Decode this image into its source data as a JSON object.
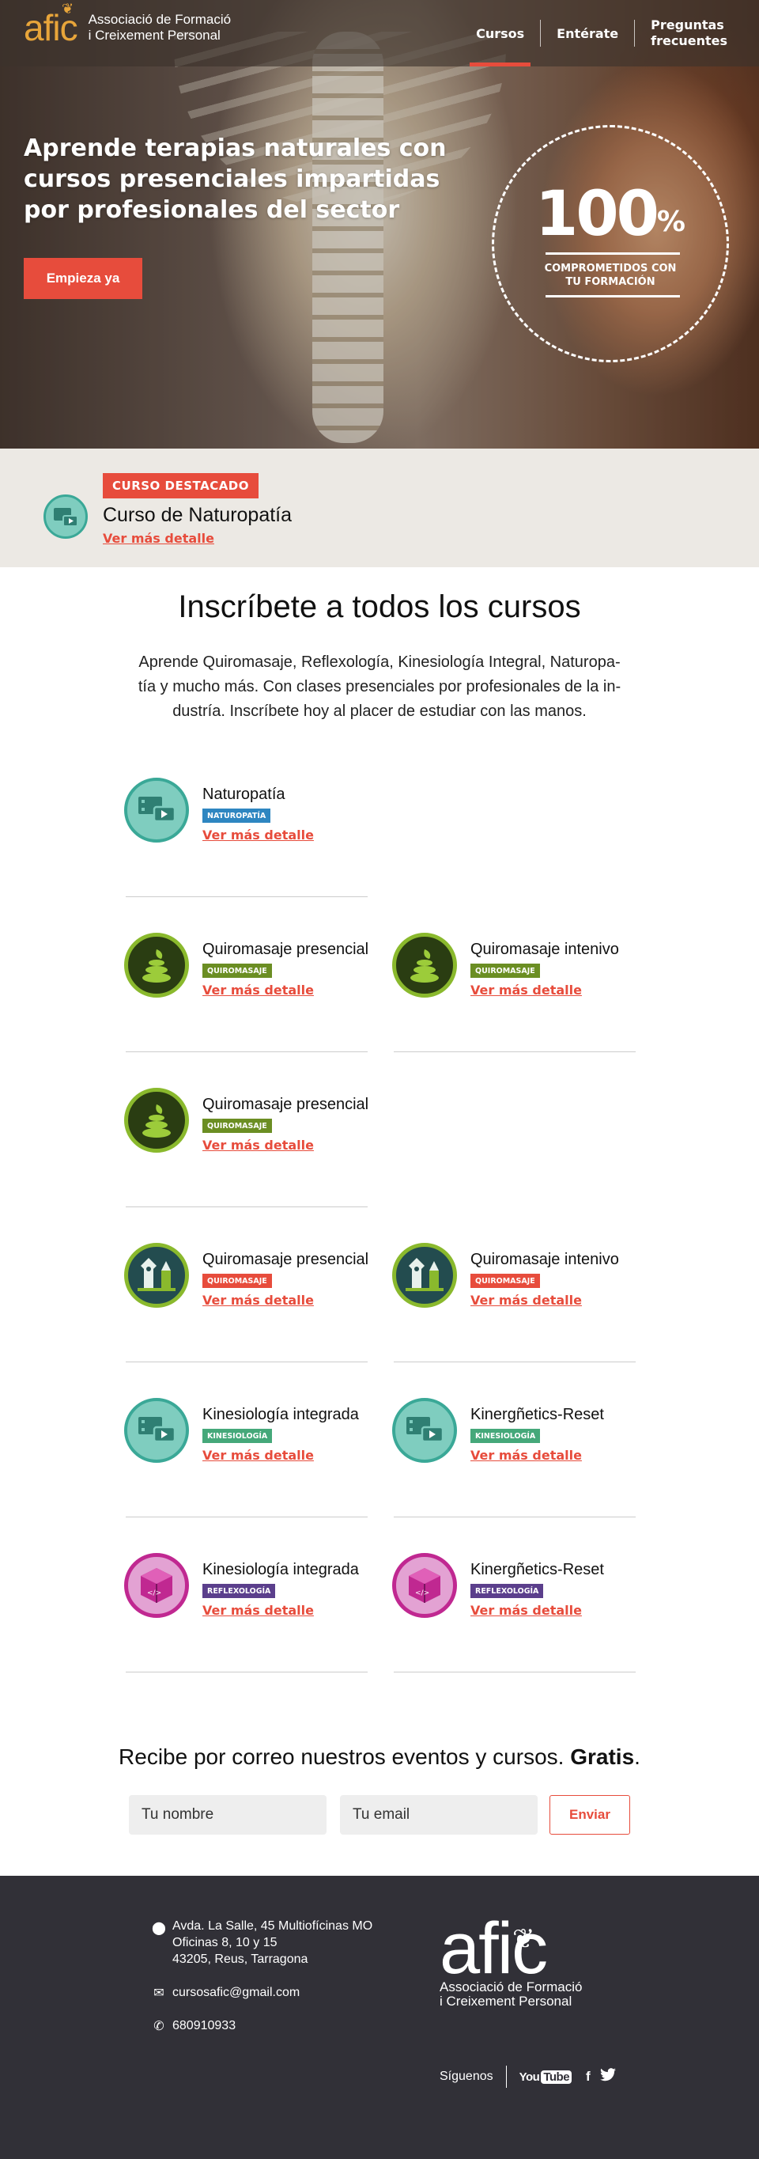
{
  "header": {
    "logo_mark": "afic",
    "logo_line1": "Associació de Formació",
    "logo_line2": "i Creixement Personal",
    "nav": [
      {
        "label": "Cursos"
      },
      {
        "label": "Entérate"
      },
      {
        "label_line1": "Preguntas",
        "label_line2": "frecuentes"
      }
    ]
  },
  "hero": {
    "title_line1": "Aprende terapias naturales con",
    "title_line2": "cursos presenciales impartidas",
    "title_line3": "por profesionales del sector",
    "cta": "Empieza ya",
    "badge_value": "100",
    "badge_unit": "%",
    "badge_text_line1": "COMPROMETIDOS CON",
    "badge_text_line2": "TU FORMACIÓN"
  },
  "featured": {
    "tag": "CURSO DESTACADO",
    "title": "Curso de Naturopatía",
    "link": "Ver más detalle",
    "icon": "video-icon"
  },
  "intro": {
    "title": "Inscríbete a todos los cursos",
    "desc_line1": "Aprende Quiromasaje, Reflexología, Kinesiología Integral, Naturopa-",
    "desc_line2": "tía y mucho más. Con clases presenciales por profesionales de la in-",
    "desc_line3": "dustría. Inscríbete hoy al placer de estudiar con las manos."
  },
  "courses": [
    {
      "name": "Naturopatía",
      "tag": "NATUROPATÍA",
      "tag_color": "#2e86c1",
      "link": "Ver más detalle",
      "icon": "video-icon"
    },
    {
      "name": "Quiromasaje presencial",
      "tag": "QUIROMASAJE",
      "tag_color": "#6b8e23",
      "link": "Ver más detalle",
      "icon": "stones-icon"
    },
    {
      "name": "Quiromasaje intenivo",
      "tag": "QUIROMASAJE",
      "tag_color": "#6b8e23",
      "link": "Ver más detalle",
      "icon": "stones-icon"
    },
    {
      "name": "Quiromasaje presencial",
      "tag": "QUIROMASAJE",
      "tag_color": "#6b8e23",
      "link": "Ver más detalle",
      "icon": "stones-icon"
    },
    {
      "name": "Quiromasaje presencial",
      "tag": "QUIROMASAJE",
      "tag_color": "#e74c3c",
      "link": "Ver más detalle",
      "icon": "pen-icon"
    },
    {
      "name": "Quiromasaje intenivo",
      "tag": "QUIROMASAJE",
      "tag_color": "#e74c3c",
      "link": "Ver más detalle",
      "icon": "pen-icon"
    },
    {
      "name": "Kinesiología integrada",
      "tag": "KINESIOLOGÍA",
      "tag_color": "#45a87a",
      "link": "Ver más detalle",
      "icon": "video-icon"
    },
    {
      "name": "Kinergñetics-Reset",
      "tag": "KINESIOLOGÍA",
      "tag_color": "#45a87a",
      "link": "Ver más detalle",
      "icon": "video-icon"
    },
    {
      "name": "Kinesiología integrada",
      "tag": "REFLEXOLOGÍA",
      "tag_color": "#5b3f8c",
      "link": "Ver más detalle",
      "icon": "box-icon"
    },
    {
      "name": "Kinergñetics-Reset",
      "tag": "REFLEXOLOGÍA",
      "tag_color": "#5b3f8c",
      "link": "Ver más detalle",
      "icon": "box-icon"
    }
  ],
  "newsletter": {
    "text": "Recibe por correo nuestros eventos y cursos.",
    "bold": "Gratis",
    "end": ".",
    "name_placeholder": "Tu nombre",
    "email_placeholder": "Tu email",
    "send": "Enviar"
  },
  "footer": {
    "address_line1": "Avda. La Salle, 45 Multiofícinas MO",
    "address_line2": "Oficinas 8, 10 y 15",
    "address_line3": "43205, Reus, Tarragona",
    "email": "cursosafic@gmail.com",
    "phone": "680910933",
    "logo_mark": "afic",
    "logo_line1": "Associació de Formació",
    "logo_line2": "i Creixement Personal",
    "follow": "Síguenos",
    "youtube_you": "You",
    "youtube_tube": "Tube",
    "facebook": "f",
    "twitter": "twitter-icon"
  }
}
